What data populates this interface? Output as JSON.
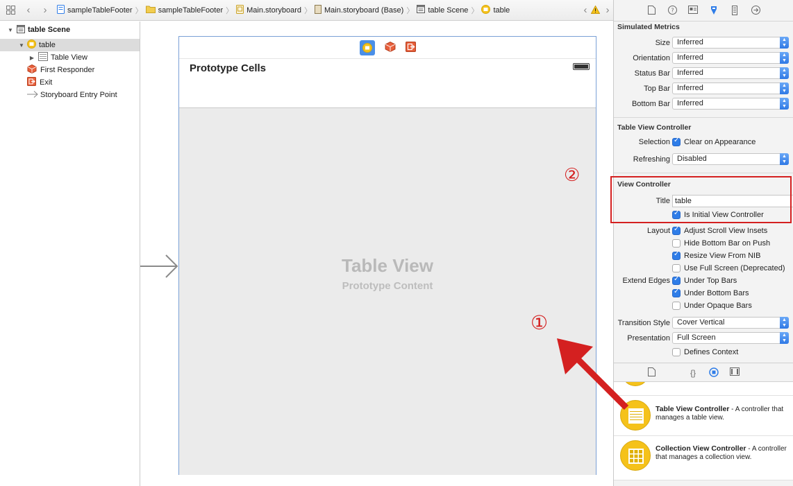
{
  "jumpbar": {
    "crumbs": [
      "sampleTableFooter",
      "sampleTableFooter",
      "Main.storyboard",
      "Main.storyboard (Base)",
      "table Scene",
      "table"
    ]
  },
  "outline": {
    "scene": "table Scene",
    "items": [
      "table",
      "Table View",
      "First Responder",
      "Exit",
      "Storyboard Entry Point"
    ]
  },
  "canvas": {
    "header_title": "Prototype Cells",
    "table_title": "Table View",
    "table_subtitle": "Prototype Content"
  },
  "inspector": {
    "simulated_metrics": {
      "header": "Simulated Metrics",
      "rows": [
        {
          "label": "Size",
          "value": "Inferred"
        },
        {
          "label": "Orientation",
          "value": "Inferred"
        },
        {
          "label": "Status Bar",
          "value": "Inferred"
        },
        {
          "label": "Top Bar",
          "value": "Inferred"
        },
        {
          "label": "Bottom Bar",
          "value": "Inferred"
        }
      ]
    },
    "table_view_controller": {
      "header": "Table View Controller",
      "selection_label": "Selection",
      "selection_check": "Clear on Appearance",
      "refreshing_label": "Refreshing",
      "refreshing_value": "Disabled"
    },
    "view_controller": {
      "header": "View Controller",
      "title_label": "Title",
      "title_value": "table",
      "initial_check": "Is Initial View Controller",
      "layout_label": "Layout",
      "layout_checks": [
        "Adjust Scroll View Insets",
        "Hide Bottom Bar on Push",
        "Resize View From NIB",
        "Use Full Screen (Deprecated)"
      ],
      "extend_label": "Extend Edges",
      "extend_checks": [
        "Under Top Bars",
        "Under Bottom Bars",
        "Under Opaque Bars"
      ],
      "transition_label": "Transition Style",
      "transition_value": "Cover Vertical",
      "presentation_label": "Presentation",
      "presentation_value": "Full Screen",
      "defines_context": "Defines Context"
    }
  },
  "library": {
    "items": [
      {
        "name": "Table View Controller",
        "desc": " - A controller that manages a table view."
      },
      {
        "name": "Collection View Controller",
        "desc": " - A controller that manages a collection view."
      }
    ]
  },
  "annotations": {
    "one": "①",
    "two": "②"
  },
  "colors": {
    "annotation_red": "#d42020",
    "selection_blue": "#2f7de8",
    "accent_yellow": "#f5c21b"
  }
}
